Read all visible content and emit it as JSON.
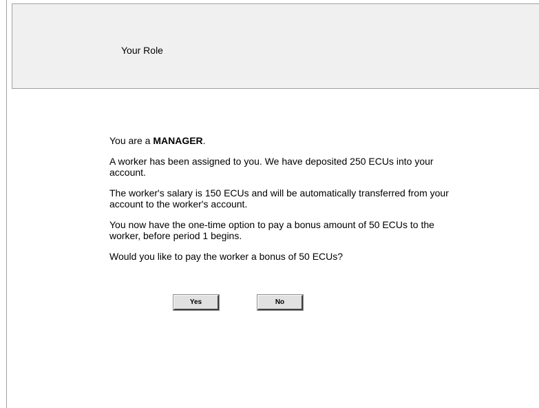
{
  "header": {
    "title": "Your Role"
  },
  "message": {
    "role_prefix": "You are a ",
    "role_name": "MANAGER",
    "role_suffix": ".",
    "paragraphs": [
      "A worker has been assigned to you. We have deposited 250 ECUs into your account.",
      "The worker's salary is 150 ECUs and will be automatically transferred from your account to the worker's account.",
      "You now have the one-time option to pay a bonus amount of 50 ECUs to the worker, before period 1 begins.",
      "Would you like to pay the worker a bonus of 50 ECUs?"
    ]
  },
  "buttons": {
    "yes_label": "Yes",
    "no_label": "No"
  }
}
